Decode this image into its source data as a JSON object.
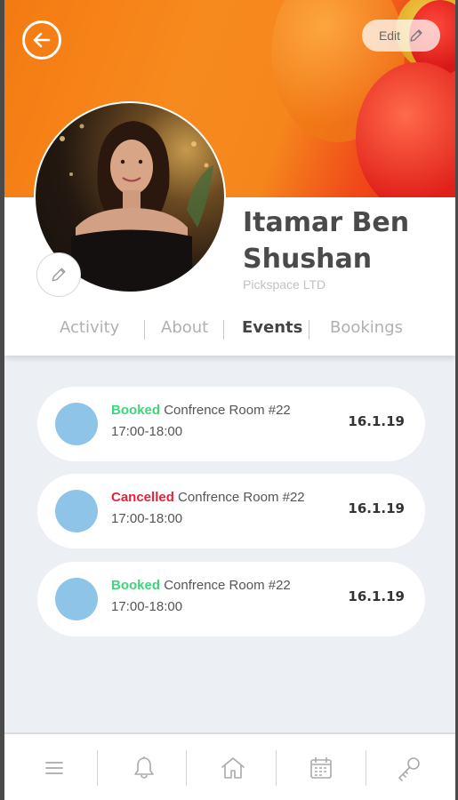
{
  "header": {
    "edit_label": "Edit",
    "back_icon": "arrow-left-icon",
    "edit_icon": "pencil-icon"
  },
  "profile": {
    "name": "Itamar Ben Shushan",
    "company": "Pickspace LTD",
    "edit_photo_icon": "pencil-icon"
  },
  "tabs": [
    {
      "label": "Activity",
      "active": false
    },
    {
      "label": "About",
      "active": false
    },
    {
      "label": "Events",
      "active": true
    },
    {
      "label": "Bookings",
      "active": false
    }
  ],
  "events": [
    {
      "status": "Booked",
      "status_color": "#3dd67a",
      "title": "Confrence Room #22",
      "time": "17:00-18:00",
      "date": "16.1.19"
    },
    {
      "status": "Cancelled",
      "status_color": "#e8203a",
      "title": "Confrence Room #22",
      "time": "17:00-18:00",
      "date": "16.1.19"
    },
    {
      "status": "Booked",
      "status_color": "#3dd67a",
      "title": "Confrence Room #22",
      "time": "17:00-18:00",
      "date": "16.1.19"
    }
  ],
  "bottom_nav": [
    {
      "icon": "menu-icon"
    },
    {
      "icon": "bell-icon"
    },
    {
      "icon": "home-icon"
    },
    {
      "icon": "calendar-icon"
    },
    {
      "icon": "key-icon"
    }
  ],
  "colors": {
    "banner_orange": "#f5861c",
    "event_dot": "#8ec4e8",
    "background": "#eceff4"
  }
}
